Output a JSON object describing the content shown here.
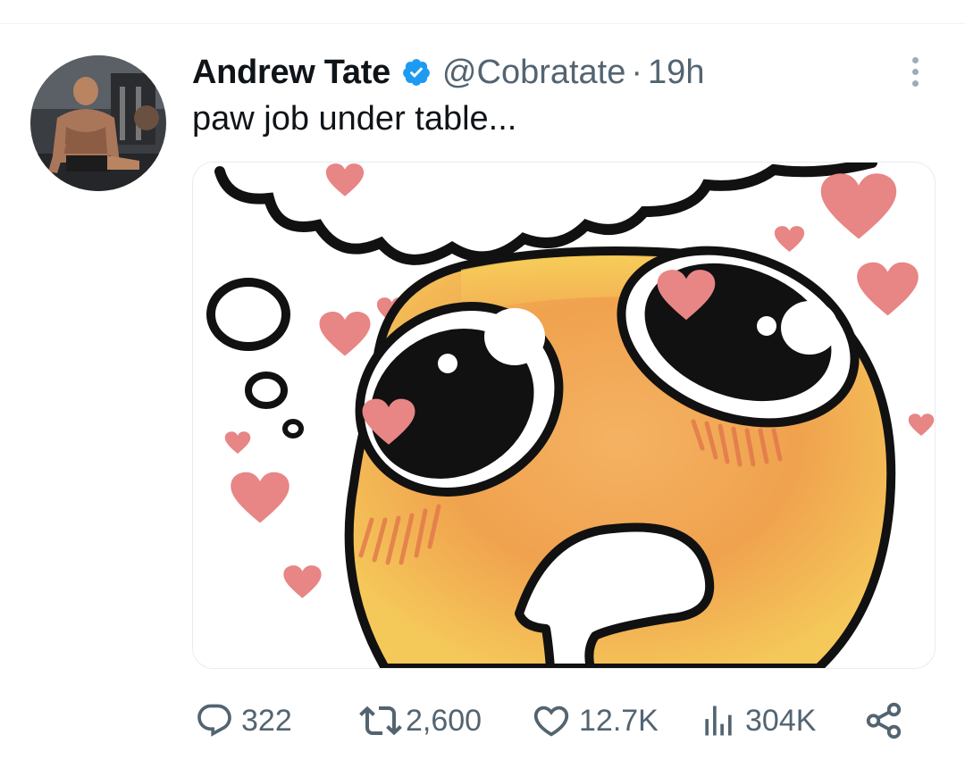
{
  "tweet": {
    "author": {
      "display_name": "Andrew Tate",
      "handle": "@Cobratate",
      "verified": true,
      "avatar_icon": "user-avatar"
    },
    "separator": "·",
    "time_ago": "19h",
    "text": "paw job under table...",
    "media": {
      "type": "image",
      "subject": "pleading-emoji-meme-with-hearts"
    }
  },
  "actions": {
    "replies": {
      "icon": "reply-icon",
      "count": "322"
    },
    "reposts": {
      "icon": "repost-icon",
      "count": "2,600"
    },
    "likes": {
      "icon": "like-icon",
      "count": "12.7K"
    },
    "views": {
      "icon": "views-icon",
      "count": "304K"
    },
    "share": {
      "icon": "share-icon"
    }
  },
  "colors": {
    "text_primary": "#0f1419",
    "text_secondary": "#536471",
    "verified_blue": "#1d9bf0",
    "divider": "#eff3f4",
    "heart_pink": "#e88585"
  }
}
